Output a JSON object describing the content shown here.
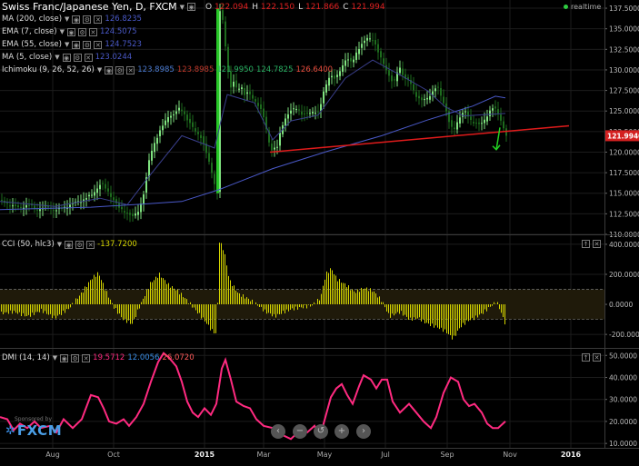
{
  "colors": {
    "background": "#000000",
    "grid": "#1c1c1c",
    "candle_up": "#7fe27f",
    "candle_down": "#1e6b1e",
    "trendline": "#e01b1b",
    "arrow": "#22d022",
    "ma200": "#4a59c8",
    "ema7": "#3a3f8c",
    "cci": "#d6d600",
    "dmi": "#ff2a80",
    "price_badge": "#d42020"
  },
  "header": {
    "symbol_title": "Swiss Franc/Japanese Yen, D, FXCM",
    "realtime_label": "realtime",
    "ohlc": [
      {
        "key": "O",
        "value": "122.094"
      },
      {
        "key": "H",
        "value": "122.150"
      },
      {
        "key": "L",
        "value": "121.866"
      },
      {
        "key": "C",
        "value": "121.994"
      }
    ]
  },
  "legends": {
    "price": [
      {
        "label": "MA (200, close)",
        "values": [
          "126.8235"
        ],
        "icon": "chevron-down-icon"
      },
      {
        "label": "EMA (7, close)",
        "values": [
          "124.5075"
        ],
        "icon": "chevron-down-icon"
      },
      {
        "label": "EMA (55, close)",
        "values": [
          "124.7523"
        ],
        "icon": "chevron-down-icon"
      },
      {
        "label": "MA (5, close)",
        "values": [
          "123.0244"
        ],
        "icon": "chevron-down-icon"
      },
      {
        "label": "Ichimoku (9, 26, 52, 26)",
        "values": [
          "123.8985",
          "123.8985",
          "121.9950",
          "124.7825",
          "126.6400"
        ],
        "icon": "chevron-down-icon"
      }
    ],
    "cci": {
      "label": "CCI (50, hlc3)",
      "value": "-137.7200"
    },
    "dmi": {
      "label": "DMI (14, 14)",
      "values": [
        "19.5712",
        "12.0056",
        "26.0720"
      ]
    }
  },
  "sponsor": {
    "text": "Sponsored by",
    "brand": "FXCM"
  },
  "chart_data": [
    {
      "type": "candlestick",
      "name": "price",
      "x_ticks": [
        "Aug",
        "Oct",
        "2015",
        "Mar",
        "May",
        "Jul",
        "Sep",
        "Nov",
        "2016"
      ],
      "y_ticks": [
        "137.5000",
        "135.0000",
        "132.5000",
        "130.0000",
        "127.5000",
        "125.0000",
        "122.5000",
        "120.0000",
        "117.5000",
        "115.0000",
        "112.5000",
        "110.0000"
      ],
      "ylim": [
        110,
        138.5
      ],
      "last_price": "121.9940",
      "close_path": [
        [
          0,
          114.0
        ],
        [
          10,
          113.6
        ],
        [
          20,
          113.2
        ],
        [
          30,
          113.6
        ],
        [
          40,
          113.0
        ],
        [
          50,
          113.4
        ],
        [
          60,
          112.9
        ],
        [
          70,
          113.3
        ],
        [
          80,
          113.8
        ],
        [
          90,
          114.2
        ],
        [
          100,
          114.8
        ],
        [
          110,
          116.2
        ],
        [
          118,
          115.2
        ],
        [
          125,
          114.0
        ],
        [
          130,
          113.2
        ],
        [
          138,
          112.7
        ],
        [
          145,
          112.1
        ],
        [
          152,
          113.0
        ],
        [
          158,
          115.3
        ],
        [
          163,
          119.0
        ],
        [
          168,
          121.0
        ],
        [
          172,
          121.8
        ],
        [
          178,
          123.2
        ],
        [
          184,
          124.4
        ],
        [
          190,
          124.5
        ],
        [
          196,
          125.3
        ],
        [
          200,
          125.1
        ],
        [
          205,
          123.9
        ],
        [
          210,
          123.1
        ],
        [
          215,
          122.5
        ],
        [
          220,
          121.8
        ],
        [
          225,
          120.2
        ],
        [
          230,
          118.5
        ],
        [
          235,
          116.2
        ],
        [
          238,
          115.0
        ],
        [
          240,
          137.5
        ],
        [
          244,
          136.0
        ],
        [
          248,
          132.0
        ],
        [
          252,
          127.6
        ],
        [
          256,
          128.5
        ],
        [
          260,
          127.5
        ],
        [
          264,
          128.2
        ],
        [
          268,
          127.0
        ],
        [
          272,
          127.2
        ],
        [
          276,
          126.7
        ],
        [
          280,
          126.2
        ],
        [
          285,
          125.4
        ],
        [
          290,
          123.9
        ],
        [
          294,
          121.6
        ],
        [
          298,
          120.3
        ],
        [
          304,
          120.6
        ],
        [
          308,
          122.8
        ],
        [
          312,
          124.0
        ],
        [
          316,
          124.6
        ],
        [
          320,
          125.1
        ],
        [
          326,
          125.4
        ],
        [
          332,
          124.5
        ],
        [
          338,
          124.7
        ],
        [
          344,
          125.0
        ],
        [
          350,
          124.8
        ],
        [
          356,
          127.8
        ],
        [
          362,
          129.4
        ],
        [
          368,
          128.8
        ],
        [
          374,
          130.2
        ],
        [
          380,
          131.4
        ],
        [
          386,
          130.8
        ],
        [
          392,
          132.4
        ],
        [
          398,
          133.2
        ],
        [
          404,
          134.0
        ],
        [
          410,
          133.6
        ],
        [
          416,
          131.8
        ],
        [
          422,
          130.6
        ],
        [
          428,
          129.0
        ],
        [
          432,
          128.2
        ],
        [
          438,
          130.6
        ],
        [
          444,
          128.9
        ],
        [
          450,
          128.6
        ],
        [
          456,
          127.0
        ],
        [
          462,
          126.2
        ],
        [
          468,
          126.5
        ],
        [
          474,
          127.2
        ],
        [
          480,
          128.0
        ],
        [
          486,
          126.4
        ],
        [
          490,
          125.0
        ],
        [
          494,
          123.2
        ],
        [
          498,
          122.6
        ],
        [
          504,
          124.2
        ],
        [
          510,
          125.0
        ],
        [
          516,
          124.0
        ],
        [
          522,
          123.5
        ],
        [
          528,
          123.3
        ],
        [
          534,
          124.3
        ],
        [
          540,
          125.4
        ],
        [
          546,
          125.0
        ],
        [
          550,
          123.9
        ],
        [
          556,
          122.0
        ]
      ],
      "ma200_path": [
        [
          0,
          113.0
        ],
        [
          100,
          113.3
        ],
        [
          160,
          113.7
        ],
        [
          200,
          114.0
        ],
        [
          240,
          115.4
        ],
        [
          300,
          118.0
        ],
        [
          360,
          120.1
        ],
        [
          420,
          122.0
        ],
        [
          470,
          123.9
        ],
        [
          520,
          125.6
        ],
        [
          545,
          126.8
        ],
        [
          556,
          126.6
        ]
      ],
      "ma_smooth_path": [
        [
          0,
          114.0
        ],
        [
          60,
          113.4
        ],
        [
          110,
          114.4
        ],
        [
          140,
          113.6
        ],
        [
          160,
          116.5
        ],
        [
          200,
          122.0
        ],
        [
          236,
          120.5
        ],
        [
          250,
          127.0
        ],
        [
          280,
          126.0
        ],
        [
          300,
          121.5
        ],
        [
          320,
          123.8
        ],
        [
          350,
          124.5
        ],
        [
          380,
          129.0
        ],
        [
          410,
          131.2
        ],
        [
          440,
          129.4
        ],
        [
          470,
          127.5
        ],
        [
          490,
          125.5
        ],
        [
          510,
          124.4
        ],
        [
          540,
          124.6
        ],
        [
          556,
          124.7
        ]
      ],
      "trendline": [
        [
          297,
          120.0
        ],
        [
          626,
          123.2
        ]
      ],
      "arrow": {
        "x": 548,
        "from": 123.0,
        "to": 120.3
      }
    },
    {
      "type": "bar",
      "name": "CCI (50, hlc3)",
      "y_ticks": [
        "400.0000",
        "200.0000",
        "0.0000",
        "-200.0000"
      ],
      "ylim": [
        -290,
        460
      ],
      "bands": [
        100,
        -100
      ],
      "path": [
        [
          0,
          -60
        ],
        [
          15,
          -50
        ],
        [
          30,
          -80
        ],
        [
          45,
          -40
        ],
        [
          60,
          -90
        ],
        [
          75,
          -30
        ],
        [
          90,
          80
        ],
        [
          100,
          170
        ],
        [
          108,
          210
        ],
        [
          116,
          90
        ],
        [
          125,
          -20
        ],
        [
          135,
          -100
        ],
        [
          145,
          -130
        ],
        [
          155,
          10
        ],
        [
          165,
          140
        ],
        [
          175,
          200
        ],
        [
          185,
          130
        ],
        [
          195,
          90
        ],
        [
          205,
          30
        ],
        [
          215,
          -40
        ],
        [
          225,
          -110
        ],
        [
          232,
          -170
        ],
        [
          238,
          -200
        ],
        [
          241,
          420
        ],
        [
          246,
          360
        ],
        [
          252,
          160
        ],
        [
          262,
          70
        ],
        [
          272,
          40
        ],
        [
          282,
          0
        ],
        [
          292,
          -50
        ],
        [
          302,
          -80
        ],
        [
          312,
          -50
        ],
        [
          322,
          -30
        ],
        [
          332,
          -20
        ],
        [
          342,
          -10
        ],
        [
          352,
          40
        ],
        [
          358,
          200
        ],
        [
          364,
          240
        ],
        [
          370,
          170
        ],
        [
          380,
          130
        ],
        [
          390,
          80
        ],
        [
          400,
          110
        ],
        [
          410,
          90
        ],
        [
          420,
          20
        ],
        [
          428,
          -80
        ],
        [
          440,
          -50
        ],
        [
          450,
          -100
        ],
        [
          460,
          -90
        ],
        [
          470,
          -130
        ],
        [
          480,
          -150
        ],
        [
          490,
          -180
        ],
        [
          498,
          -230
        ],
        [
          506,
          -150
        ],
        [
          514,
          -110
        ],
        [
          522,
          -90
        ],
        [
          530,
          -60
        ],
        [
          538,
          -20
        ],
        [
          546,
          20
        ],
        [
          550,
          -40
        ],
        [
          556,
          -140
        ]
      ]
    },
    {
      "type": "line",
      "name": "DMI (14, 14)",
      "y_ticks": [
        "50.0000",
        "40.0000",
        "30.0000",
        "20.0000",
        "10.0000"
      ],
      "ylim": [
        8,
        53
      ],
      "path": [
        [
          0,
          22
        ],
        [
          8,
          21
        ],
        [
          15,
          16
        ],
        [
          22,
          19
        ],
        [
          30,
          17
        ],
        [
          38,
          20
        ],
        [
          45,
          17
        ],
        [
          55,
          18
        ],
        [
          62,
          15
        ],
        [
          70,
          21
        ],
        [
          80,
          17
        ],
        [
          90,
          21
        ],
        [
          100,
          32
        ],
        [
          108,
          31
        ],
        [
          114,
          26
        ],
        [
          120,
          20
        ],
        [
          128,
          19
        ],
        [
          136,
          21
        ],
        [
          142,
          18
        ],
        [
          150,
          22
        ],
        [
          158,
          28
        ],
        [
          166,
          38
        ],
        [
          174,
          47
        ],
        [
          180,
          51
        ],
        [
          186,
          49
        ],
        [
          194,
          45
        ],
        [
          200,
          38
        ],
        [
          206,
          29
        ],
        [
          212,
          24
        ],
        [
          218,
          22
        ],
        [
          225,
          26
        ],
        [
          232,
          23
        ],
        [
          238,
          28
        ],
        [
          244,
          44
        ],
        [
          248,
          48
        ],
        [
          254,
          39
        ],
        [
          260,
          29
        ],
        [
          268,
          27
        ],
        [
          275,
          26
        ],
        [
          282,
          21
        ],
        [
          290,
          18
        ],
        [
          300,
          17
        ],
        [
          310,
          14
        ],
        [
          320,
          12
        ],
        [
          330,
          16
        ],
        [
          338,
          15
        ],
        [
          346,
          18
        ],
        [
          352,
          13
        ],
        [
          358,
          22
        ],
        [
          364,
          31
        ],
        [
          370,
          35
        ],
        [
          376,
          37
        ],
        [
          382,
          32
        ],
        [
          388,
          28
        ],
        [
          395,
          36
        ],
        [
          400,
          41
        ],
        [
          408,
          39
        ],
        [
          414,
          35
        ],
        [
          420,
          39
        ],
        [
          426,
          39
        ],
        [
          432,
          29
        ],
        [
          440,
          24
        ],
        [
          450,
          28
        ],
        [
          458,
          24
        ],
        [
          466,
          20
        ],
        [
          474,
          17
        ],
        [
          480,
          22
        ],
        [
          488,
          33
        ],
        [
          496,
          40
        ],
        [
          504,
          38
        ],
        [
          510,
          30
        ],
        [
          516,
          27
        ],
        [
          522,
          28
        ],
        [
          530,
          24
        ],
        [
          536,
          19
        ],
        [
          542,
          17
        ],
        [
          548,
          17
        ],
        [
          556,
          20
        ]
      ]
    }
  ]
}
